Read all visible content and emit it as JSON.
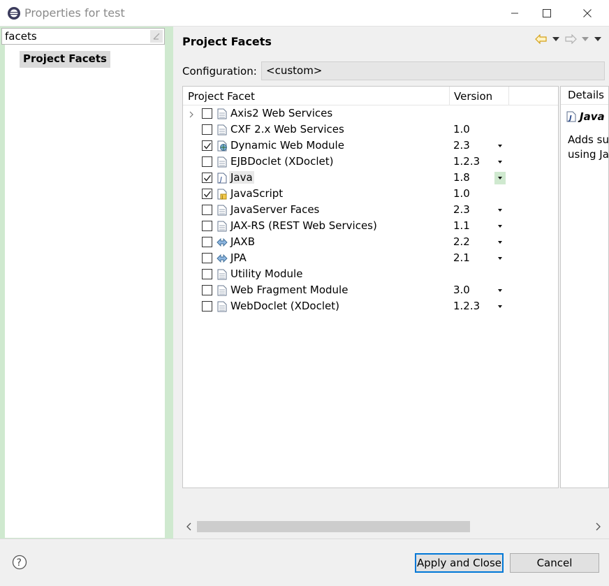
{
  "window": {
    "title": "Properties for test"
  },
  "sidebar": {
    "filter_value": "facets",
    "selected_item": "Project Facets"
  },
  "page": {
    "title": "Project Facets",
    "configuration_label": "Configuration:",
    "configuration_value": "<custom>"
  },
  "table": {
    "col_facet": "Project Facet",
    "col_version": "Version",
    "rows": [
      {
        "name": "Axis2 Web Services",
        "version": "",
        "checked": false,
        "expandable": true,
        "has_dropdown": false,
        "icon": "document-icon"
      },
      {
        "name": "CXF 2.x Web Services",
        "version": "1.0",
        "checked": false,
        "expandable": false,
        "has_dropdown": false,
        "icon": "document-icon"
      },
      {
        "name": "Dynamic Web Module",
        "version": "2.3",
        "checked": true,
        "expandable": false,
        "has_dropdown": true,
        "icon": "web-module-icon"
      },
      {
        "name": "EJBDoclet (XDoclet)",
        "version": "1.2.3",
        "checked": false,
        "expandable": false,
        "has_dropdown": true,
        "icon": "document-icon"
      },
      {
        "name": "Java",
        "version": "1.8",
        "checked": true,
        "expandable": false,
        "has_dropdown": true,
        "icon": "java-icon",
        "highlighted": true
      },
      {
        "name": "JavaScript",
        "version": "1.0",
        "checked": true,
        "expandable": false,
        "has_dropdown": false,
        "icon": "javascript-icon"
      },
      {
        "name": "JavaServer Faces",
        "version": "2.3",
        "checked": false,
        "expandable": false,
        "has_dropdown": true,
        "icon": "document-icon"
      },
      {
        "name": "JAX-RS (REST Web Services)",
        "version": "1.1",
        "checked": false,
        "expandable": false,
        "has_dropdown": true,
        "icon": "document-icon"
      },
      {
        "name": "JAXB",
        "version": "2.2",
        "checked": false,
        "expandable": false,
        "has_dropdown": true,
        "icon": "jaxb-icon"
      },
      {
        "name": "JPA",
        "version": "2.1",
        "checked": false,
        "expandable": false,
        "has_dropdown": true,
        "icon": "jpa-icon"
      },
      {
        "name": "Utility Module",
        "version": "",
        "checked": false,
        "expandable": false,
        "has_dropdown": false,
        "icon": "document-icon"
      },
      {
        "name": "Web Fragment Module",
        "version": "3.0",
        "checked": false,
        "expandable": false,
        "has_dropdown": true,
        "icon": "document-icon"
      },
      {
        "name": "WebDoclet (XDoclet)",
        "version": "1.2.3",
        "checked": false,
        "expandable": false,
        "has_dropdown": true,
        "icon": "document-icon"
      }
    ]
  },
  "details": {
    "tab_label": "Details",
    "facet_name": "Java",
    "description": "Adds su\nusing Ja"
  },
  "buttons": {
    "apply_close": "Apply and Close",
    "cancel": "Cancel"
  },
  "colors": {
    "sidebar_accent": "#cfe9cf",
    "default_button_border": "#0078d7"
  }
}
